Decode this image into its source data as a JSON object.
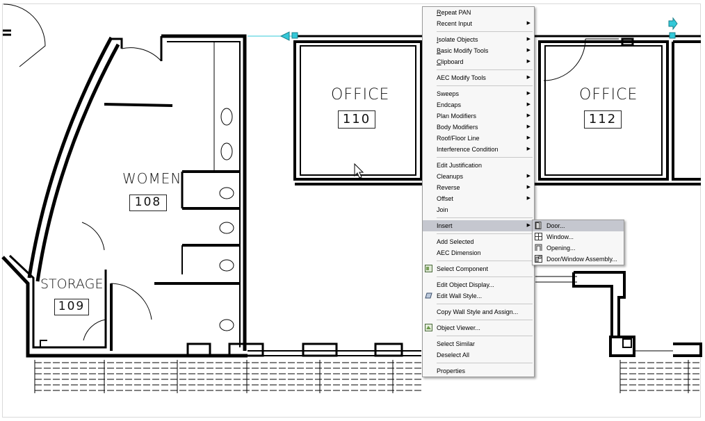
{
  "rooms": [
    {
      "id": "office-110",
      "name": "OFFICE",
      "number": "110"
    },
    {
      "id": "office-112",
      "name": "OFFICE",
      "number": "112"
    },
    {
      "id": "women-108",
      "name": "WOMEN",
      "number": "108"
    },
    {
      "id": "storage-109",
      "name": "STORAGE",
      "number": "109"
    }
  ],
  "context_menu": {
    "items": [
      {
        "key": "repeat",
        "accel": "R",
        "rest": "epeat PAN",
        "submenu": false
      },
      {
        "key": "recent",
        "accel": "",
        "rest": "Recent Input",
        "submenu": true
      },
      {
        "sep": true
      },
      {
        "key": "isolate",
        "accel": "I",
        "rest": "solate Objects",
        "submenu": true
      },
      {
        "key": "basic-modify",
        "accel": "B",
        "rest": "asic Modify Tools",
        "submenu": true
      },
      {
        "key": "clipboard",
        "accel": "C",
        "rest": "lipboard",
        "submenu": true
      },
      {
        "sep": true
      },
      {
        "key": "aec-modify",
        "accel": "",
        "rest": "AEC Modify Tools",
        "submenu": true
      },
      {
        "sep": true
      },
      {
        "key": "sweeps",
        "accel": "",
        "rest": "Sweeps",
        "submenu": true
      },
      {
        "key": "endcaps",
        "accel": "",
        "rest": "Endcaps",
        "submenu": true
      },
      {
        "key": "plan-modifiers",
        "accel": "",
        "rest": "Plan Modifiers",
        "submenu": true
      },
      {
        "key": "body-modifiers",
        "accel": "",
        "rest": "Body Modifiers",
        "submenu": true
      },
      {
        "key": "roof-floor",
        "accel": "",
        "rest": "Roof/Floor Line",
        "submenu": true
      },
      {
        "key": "interference",
        "accel": "",
        "rest": "Interference Condition",
        "submenu": true
      },
      {
        "sep": true
      },
      {
        "key": "edit-justification",
        "accel": "",
        "rest": "Edit Justification",
        "submenu": false
      },
      {
        "key": "cleanups",
        "accel": "",
        "rest": "Cleanups",
        "submenu": true
      },
      {
        "key": "reverse",
        "accel": "",
        "rest": "Reverse",
        "submenu": true
      },
      {
        "key": "offset",
        "accel": "",
        "rest": "Offset",
        "submenu": true
      },
      {
        "key": "join",
        "accel": "",
        "rest": "Join",
        "submenu": false
      },
      {
        "sep": true
      },
      {
        "key": "insert",
        "accel": "",
        "rest": "Insert",
        "submenu": true,
        "highlight": true
      },
      {
        "sep": true
      },
      {
        "key": "add-selected",
        "accel": "",
        "rest": "Add Selected",
        "submenu": false
      },
      {
        "key": "aec-dimension",
        "accel": "",
        "rest": "AEC Dimension",
        "submenu": false
      },
      {
        "sep": true
      },
      {
        "key": "select-component",
        "accel": "",
        "rest": "Select Component",
        "submenu": false,
        "icon": "select-component-icon"
      },
      {
        "sep": true
      },
      {
        "key": "edit-object-display",
        "accel": "",
        "rest": "Edit Object Display...",
        "submenu": false
      },
      {
        "key": "edit-wall-style",
        "accel": "",
        "rest": "Edit Wall Style...",
        "submenu": false,
        "icon": "wall-style-icon"
      },
      {
        "sep": true
      },
      {
        "key": "copy-wall-style",
        "accel": "",
        "rest": "Copy Wall Style and Assign...",
        "submenu": false
      },
      {
        "sep": true
      },
      {
        "key": "object-viewer",
        "accel": "",
        "rest": "Object Viewer...",
        "submenu": false,
        "icon": "object-viewer-icon"
      },
      {
        "sep": true
      },
      {
        "key": "select-similar",
        "accel": "",
        "rest": "Select Similar",
        "submenu": false
      },
      {
        "key": "deselect-all",
        "accel": "",
        "rest": "Deselect All",
        "submenu": false
      },
      {
        "sep": true
      },
      {
        "key": "properties",
        "accel": "",
        "rest": "Properties",
        "submenu": false
      }
    ]
  },
  "insert_submenu": {
    "items": [
      {
        "key": "door",
        "label": "Door...",
        "icon": "door-icon",
        "highlight": true
      },
      {
        "key": "window",
        "label": "Window...",
        "icon": "window-icon"
      },
      {
        "key": "opening",
        "label": "Opening...",
        "icon": "opening-icon"
      },
      {
        "key": "door-window-assembly",
        "label": "Door/Window Assembly...",
        "icon": "door-window-assembly-icon"
      }
    ]
  },
  "colors": {
    "grip": "#33c8d8",
    "wall": "#000000",
    "highlight": "#c5c7cf"
  }
}
